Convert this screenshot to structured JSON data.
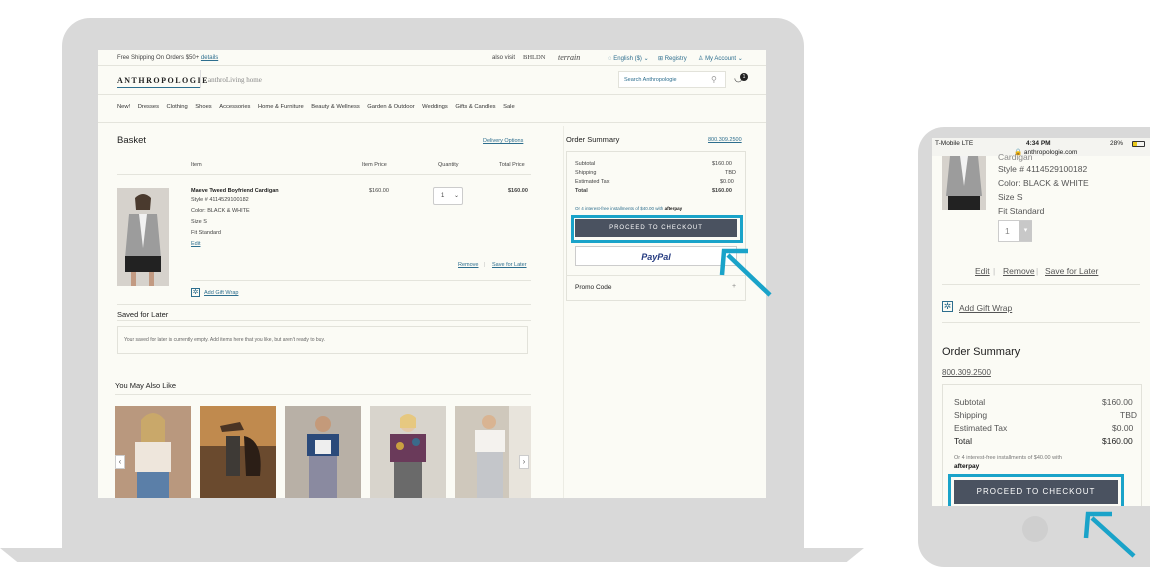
{
  "topbar": {
    "shipping": "Free Shipping On Orders $50+",
    "details": "details",
    "also_visit": "also visit",
    "bhldn": "BHLDN",
    "terrain": "terrain",
    "language": "English ($)",
    "registry": "Registry",
    "account": "My Account"
  },
  "header": {
    "logo": "ANTHROPOLOGIE",
    "home_logo": "anthroLiving home",
    "search_placeholder": "Search Anthropologie",
    "cart_count": "1"
  },
  "nav": [
    "New!",
    "Dresses",
    "Clothing",
    "Shoes",
    "Accessories",
    "Home & Furniture",
    "Beauty & Wellness",
    "Garden & Outdoor",
    "Weddings",
    "Gifts & Candles",
    "Sale"
  ],
  "basket": {
    "title": "Basket",
    "delivery_options": "Delivery Options",
    "col_item": "Item",
    "col_price": "Item Price",
    "col_qty": "Quantity",
    "col_total": "Total Price",
    "product_name": "Maeve Tweed Boyfriend Cardigan",
    "style": "Style # 4114529100182",
    "color": "Color: BLACK & WHITE",
    "size": "Size S",
    "fit": "Fit Standard",
    "edit": "Edit",
    "item_price": "$160.00",
    "quantity": "1",
    "total_price": "$160.00",
    "remove": "Remove",
    "save_for_later": "Save for Later",
    "add_gift_wrap": "Add Gift Wrap"
  },
  "saved": {
    "title": "Saved for Later",
    "empty": "Your saved for later is currently empty. Add items here that you like, but aren't ready to buy."
  },
  "also_like": {
    "title": "You May Also Like"
  },
  "summary": {
    "title": "Order Summary",
    "phone": "800.309.2500",
    "subtotal_label": "Subtotal",
    "subtotal": "$160.00",
    "shipping_label": "Shipping",
    "shipping": "TBD",
    "tax_label": "Estimated Tax",
    "tax": "$0.00",
    "total_label": "Total",
    "total": "$160.00",
    "afterpay": "Or 4 interest-free installments of $40.00 with",
    "afterpay_brand": "afterpay",
    "checkout": "PROCEED TO CHECKOUT",
    "paypal": "PayPal",
    "promo": "Promo Code"
  },
  "mobile": {
    "carrier": "T-Mobile  LTE",
    "time": "4:34 PM",
    "battery": "28%",
    "url": "anthropologie.com",
    "cropped": "Cardigan",
    "style": "Style # 4114529100182",
    "color": "Color: BLACK & WHITE",
    "size": "Size S",
    "fit": "Fit Standard",
    "qty": "1",
    "edit": "Edit",
    "remove": "Remove",
    "save_for_later": "Save for Later",
    "add_gift_wrap": "Add Gift Wrap",
    "summary_title": "Order Summary",
    "phone": "800.309.2500",
    "subtotal_label": "Subtotal",
    "subtotal": "$160.00",
    "shipping_label": "Shipping",
    "shipping": "TBD",
    "tax_label": "Estimated Tax",
    "tax": "$0.00",
    "total_label": "Total",
    "total": "$160.00",
    "afterpay": "Or 4 interest-free installments of $40.00 with",
    "afterpay_brand": "afterpay",
    "checkout": "PROCEED TO CHECKOUT"
  },
  "colors": {
    "highlight": "#1aa3c9",
    "button": "#4a5260",
    "link": "#2d6e8e"
  }
}
